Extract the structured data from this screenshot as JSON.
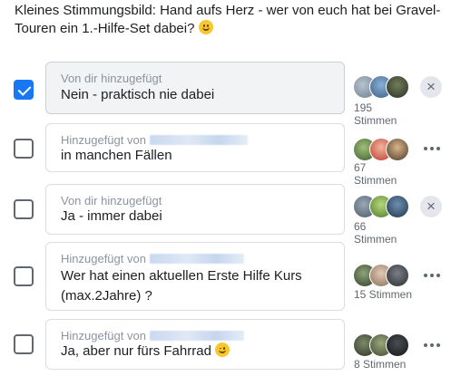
{
  "question": {
    "text": "Kleines Stimmungsbild: Hand aufs Herz - wer von euch hat bei Gravel-Touren ein 1.-Hilfe-Set dabei?"
  },
  "options": [
    {
      "checked": true,
      "added_by": "Von dir hinzugefügt",
      "answer": "Nein - praktisch nie dabei",
      "votes_count": "195",
      "votes_label": "Stimmen",
      "action": "remove"
    },
    {
      "checked": false,
      "added_by": "Hinzugefügt von",
      "answer": "in manchen Fällen",
      "votes_count": "67",
      "votes_label": "Stimmen",
      "action": "more"
    },
    {
      "checked": false,
      "added_by": "Von dir hinzugefügt",
      "answer": "Ja - immer dabei",
      "votes_count": "66",
      "votes_label": "Stimmen",
      "action": "remove"
    },
    {
      "checked": false,
      "added_by": "Hinzugefügt von",
      "answer_line1": "Wer hat einen aktuellen Erste Hilfe Kurs",
      "answer_line2": "(max.2Jahre) ?",
      "votes_text": "15 Stimmen",
      "action": "more"
    },
    {
      "checked": false,
      "added_by": "Hinzugefügt von",
      "answer": "Ja, aber nur fürs Fahrrad",
      "votes_text": "8 Stimmen",
      "action": "more"
    }
  ],
  "icons": {
    "remove": "close-icon",
    "more": "more-dots-icon",
    "check": "checkmark-icon"
  },
  "colors": {
    "accent": "#1877f2",
    "text": "#1c1e21",
    "muted": "#8d949e"
  }
}
